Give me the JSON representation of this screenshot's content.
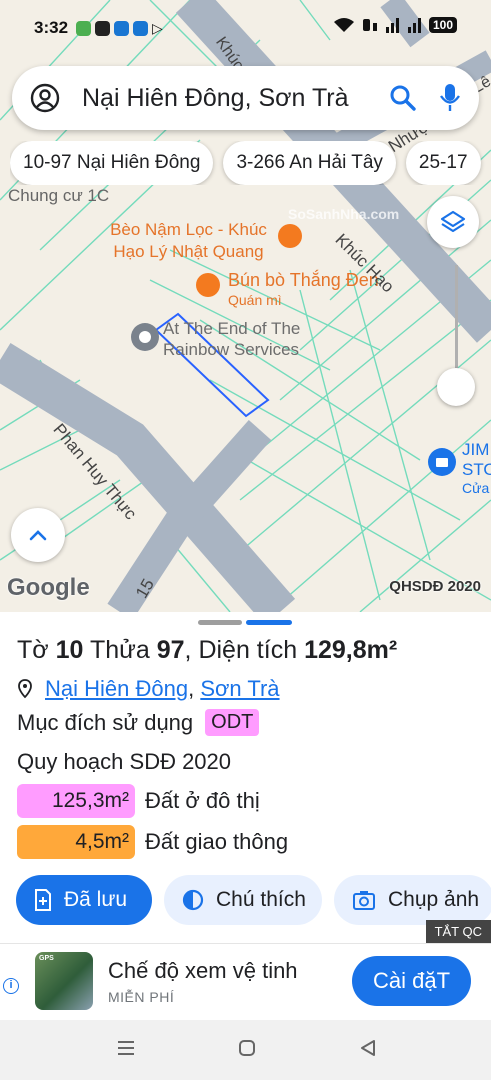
{
  "status_bar": {
    "time": "3:32",
    "app_icons": [
      "Z",
      "Zalo",
      "Zalo"
    ],
    "battery": "100"
  },
  "search": {
    "query": "Nại Hiên Đông, Sơn Trà"
  },
  "chips": [
    "10-97 Nại Hiên Đông",
    "3-266 An Hải Tây",
    "25-17"
  ],
  "map": {
    "poi_apartment": "Chung cư 1C",
    "poi_restaurant_1": "Bèo Nậm Lọc - Khúc Hạo Lý Nhật Quang",
    "poi_restaurant_2_name": "Bún bò Thắng Đen",
    "poi_restaurant_2_type": "Quán mì",
    "poi_service": "At The End of The Rainbow Services",
    "poi_shop": "JIM STO",
    "poi_shop_sub": "Cửa",
    "street_1": "Khúc Hạo",
    "street_2": "Phan Huy Thực",
    "street_3": "Khúc",
    "street_4": "Nhượng",
    "street_5": "Lê",
    "street_num": "15",
    "watermark": "SoSanhNha.com",
    "attribution": "Google",
    "layer_label": "QHSDĐ 2020"
  },
  "parcel": {
    "sheet_label": "Tờ",
    "sheet_no": "10",
    "lot_label": "Thửa",
    "lot_no": "97",
    "area_label": "Diện tích",
    "area_value": "129,8m²",
    "ward": "Nại Hiên Đông",
    "district": "Sơn Trà",
    "purpose_label": "Mục đích sử dụng",
    "purpose_code": "ODT",
    "plan_label": "Quy hoạch SDĐ 2020",
    "zones": [
      {
        "area": "125,3m²",
        "name": "Đất ở đô thị",
        "color": "#ff9cff"
      },
      {
        "area": "4,5m²",
        "name": "Đất giao thông",
        "color": "#ffa83a"
      }
    ]
  },
  "actions": {
    "saved": "Đã lưu",
    "legend": "Chú thích",
    "capture": "Chụp ảnh"
  },
  "ad": {
    "close_tag": "TẮT QC",
    "title": "Chế độ xem vệ tinh",
    "subtitle": "MIỄN PHÍ",
    "cta": "Cài đặT",
    "icon_text": "GPS"
  },
  "colors": {
    "accent": "#1a73e8",
    "road": "#a9b4c2",
    "parcel_line": "#5fd8b5",
    "selection": "#2962ff",
    "poi_orange": "#f37a1f"
  }
}
